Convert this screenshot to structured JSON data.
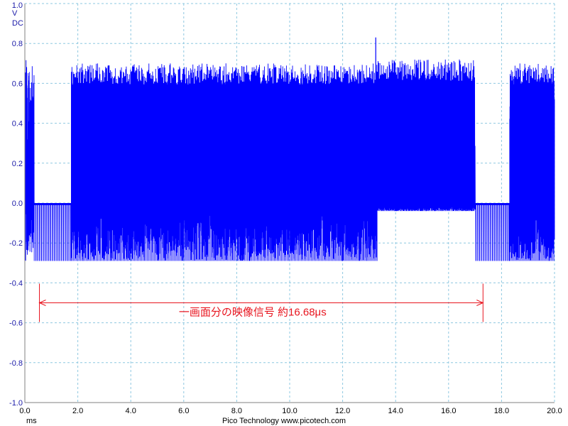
{
  "chart_data": {
    "type": "line",
    "title": "",
    "ylabel": "V",
    "ylabel_sub": "DC",
    "xlabel": "ms",
    "footer": "Pico Technology  www.picotech.com",
    "xlim": [
      0,
      20
    ],
    "ylim": [
      -1.0,
      1.0
    ],
    "xticks": [
      "0.0",
      "2.0",
      "4.0",
      "6.0",
      "8.0",
      "10.0",
      "12.0",
      "14.0",
      "16.0",
      "18.0",
      "20.0"
    ],
    "yticks": [
      "1.0",
      "0.8",
      "0.6",
      "0.4",
      "0.2",
      "0.0",
      "-0.2",
      "-0.4",
      "-0.6",
      "-0.8",
      "-1.0"
    ],
    "grid": true,
    "colors": {
      "trace": "#0000ff",
      "grid": "#8ec8e0",
      "annotation": "#e8141e"
    },
    "series": [
      {
        "regions": [
          {
            "x0": 0.0,
            "x1": 0.35,
            "kind": "burst",
            "high": 0.72,
            "low": -0.29
          },
          {
            "x0": 0.35,
            "x1": 1.75,
            "kind": "sync",
            "high": 0.0,
            "low": -0.29
          },
          {
            "x0": 1.75,
            "x1": 13.3,
            "kind": "video",
            "high": 0.7,
            "low": -0.29
          },
          {
            "x0": 13.3,
            "x1": 17.0,
            "kind": "video",
            "high": 0.72,
            "low": -0.04
          },
          {
            "x0": 17.0,
            "x1": 18.3,
            "kind": "sync",
            "high": 0.0,
            "low": -0.29
          },
          {
            "x0": 18.3,
            "x1": 20.0,
            "kind": "video",
            "high": 0.7,
            "low": -0.29
          }
        ],
        "peak": {
          "x": 13.25,
          "y": 0.83
        }
      }
    ],
    "annotation": {
      "text": "一画面分の映像信号 約16.68μs",
      "x_start": 0.55,
      "x_end": 17.3,
      "y": -0.5
    }
  }
}
